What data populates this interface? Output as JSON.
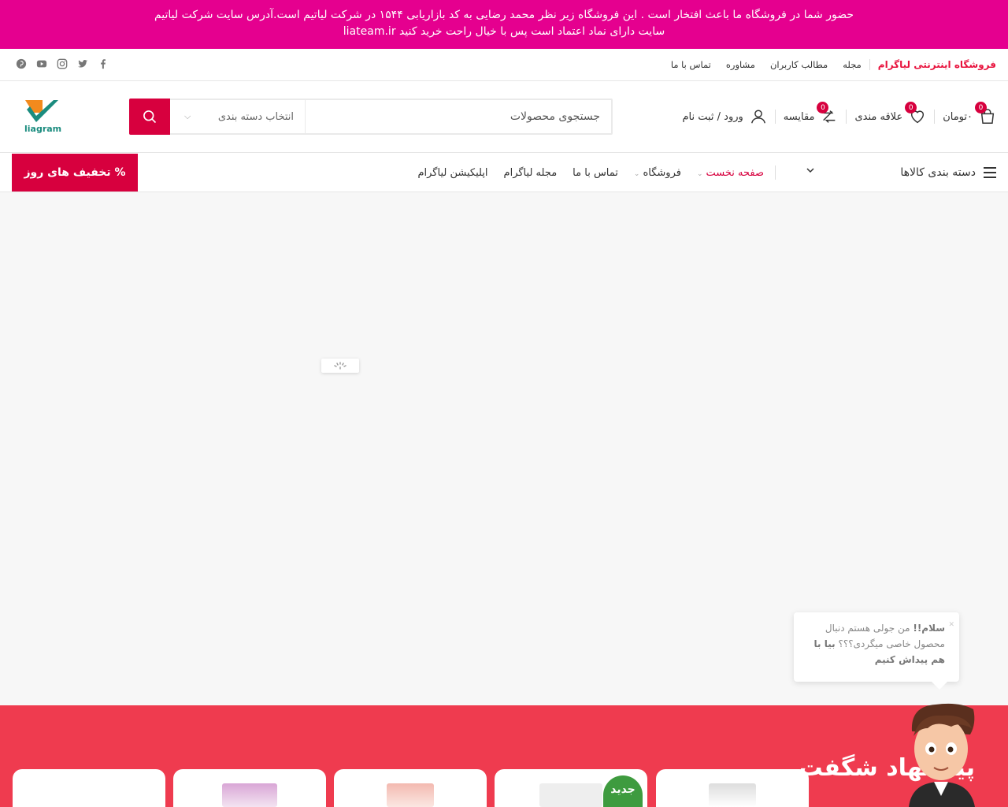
{
  "announcement": {
    "line1": "حضور شما در فروشگاه ما باعث افتخار است . این فروشگاه زیر نظر محمد رضایی به کد بازاریابی ۱۵۴۴ در شرکت لیاتیم است.آدرس سایت شرکت لیاتیم",
    "line2": "liateam.ir سایت دارای نماد اعتماد است پس با خیال راحت خرید کنید"
  },
  "toplinks": {
    "brand": "فروشگاه اینترنتی لیاگرام",
    "items": [
      "مجله",
      "مطالب کاربران",
      "مشاوره",
      "تماس با ما"
    ]
  },
  "socials": [
    "facebook-icon",
    "twitter-icon",
    "instagram-icon",
    "youtube-icon",
    "pinterest-icon"
  ],
  "logo": {
    "text": "liagram"
  },
  "search": {
    "placeholder": "جستجوی محصولات",
    "category_label": "انتخاب دسته بندی"
  },
  "header_actions": {
    "cart_label": "۰تومان",
    "cart_count": "0",
    "wishlist_label": "علاقه مندی",
    "wishlist_count": "0",
    "compare_label": "مقایسه",
    "compare_count": "0",
    "account_label": "ورود / ثبت نام"
  },
  "nav": {
    "categories_label": "دسته بندی کالاها",
    "menu": [
      {
        "label": "صفحه نخست",
        "active": true
      },
      {
        "label": "فروشگاه"
      },
      {
        "label": "تماس با ما"
      },
      {
        "label": "مجله لیاگرام"
      },
      {
        "label": "اپلیکیشن لیاگرام"
      }
    ],
    "deal_label": "% تخفیف های روز"
  },
  "chat": {
    "greeting": "سلام!!",
    "text": " من جولی هستم دنبال محصول خاصی میگردی؟؟؟ ",
    "cta": "بیا با هم پیداش کنیم"
  },
  "suggestion": {
    "title": "پیشنهاد شگفت",
    "new_badge": "جدید"
  },
  "colors": {
    "announcement_bg": "#e5008f",
    "accent": "#d7003e",
    "section_bg": "#ef3b4f",
    "new_badge": "#3e9b3f"
  }
}
